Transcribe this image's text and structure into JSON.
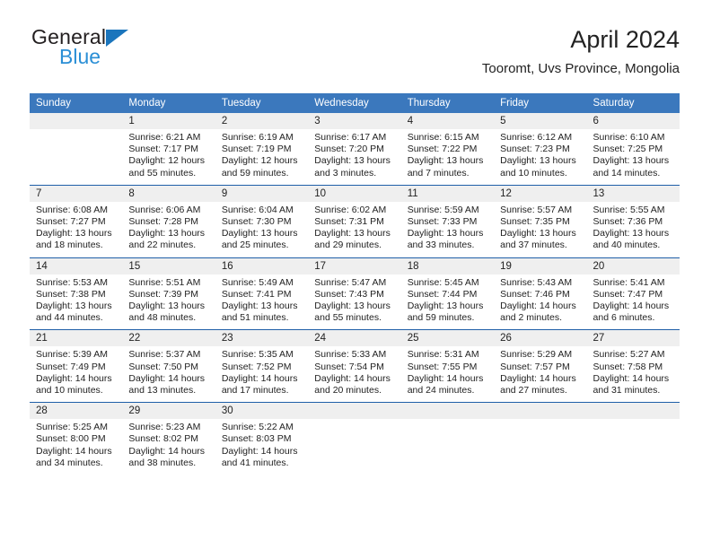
{
  "brand": {
    "word1": "General",
    "word2": "Blue",
    "triangle_color": "#1b75bc",
    "word2_color": "#2b8fd6"
  },
  "header": {
    "title": "April 2024",
    "subtitle": "Tooromt, Uvs Province, Mongolia"
  },
  "theme": {
    "header_bg": "#3b78bd",
    "daynum_bg": "#efefef",
    "separator": "#1f5fa8",
    "text": "#222222"
  },
  "calendar": {
    "weekday_headers": [
      "Sunday",
      "Monday",
      "Tuesday",
      "Wednesday",
      "Thursday",
      "Friday",
      "Saturday"
    ],
    "weeks": [
      {
        "days": [
          {
            "num": "",
            "lines": []
          },
          {
            "num": "1",
            "lines": [
              "Sunrise: 6:21 AM",
              "Sunset: 7:17 PM",
              "Daylight: 12 hours",
              "and 55 minutes."
            ]
          },
          {
            "num": "2",
            "lines": [
              "Sunrise: 6:19 AM",
              "Sunset: 7:19 PM",
              "Daylight: 12 hours",
              "and 59 minutes."
            ]
          },
          {
            "num": "3",
            "lines": [
              "Sunrise: 6:17 AM",
              "Sunset: 7:20 PM",
              "Daylight: 13 hours",
              "and 3 minutes."
            ]
          },
          {
            "num": "4",
            "lines": [
              "Sunrise: 6:15 AM",
              "Sunset: 7:22 PM",
              "Daylight: 13 hours",
              "and 7 minutes."
            ]
          },
          {
            "num": "5",
            "lines": [
              "Sunrise: 6:12 AM",
              "Sunset: 7:23 PM",
              "Daylight: 13 hours",
              "and 10 minutes."
            ]
          },
          {
            "num": "6",
            "lines": [
              "Sunrise: 6:10 AM",
              "Sunset: 7:25 PM",
              "Daylight: 13 hours",
              "and 14 minutes."
            ]
          }
        ]
      },
      {
        "days": [
          {
            "num": "7",
            "lines": [
              "Sunrise: 6:08 AM",
              "Sunset: 7:27 PM",
              "Daylight: 13 hours",
              "and 18 minutes."
            ]
          },
          {
            "num": "8",
            "lines": [
              "Sunrise: 6:06 AM",
              "Sunset: 7:28 PM",
              "Daylight: 13 hours",
              "and 22 minutes."
            ]
          },
          {
            "num": "9",
            "lines": [
              "Sunrise: 6:04 AM",
              "Sunset: 7:30 PM",
              "Daylight: 13 hours",
              "and 25 minutes."
            ]
          },
          {
            "num": "10",
            "lines": [
              "Sunrise: 6:02 AM",
              "Sunset: 7:31 PM",
              "Daylight: 13 hours",
              "and 29 minutes."
            ]
          },
          {
            "num": "11",
            "lines": [
              "Sunrise: 5:59 AM",
              "Sunset: 7:33 PM",
              "Daylight: 13 hours",
              "and 33 minutes."
            ]
          },
          {
            "num": "12",
            "lines": [
              "Sunrise: 5:57 AM",
              "Sunset: 7:35 PM",
              "Daylight: 13 hours",
              "and 37 minutes."
            ]
          },
          {
            "num": "13",
            "lines": [
              "Sunrise: 5:55 AM",
              "Sunset: 7:36 PM",
              "Daylight: 13 hours",
              "and 40 minutes."
            ]
          }
        ]
      },
      {
        "days": [
          {
            "num": "14",
            "lines": [
              "Sunrise: 5:53 AM",
              "Sunset: 7:38 PM",
              "Daylight: 13 hours",
              "and 44 minutes."
            ]
          },
          {
            "num": "15",
            "lines": [
              "Sunrise: 5:51 AM",
              "Sunset: 7:39 PM",
              "Daylight: 13 hours",
              "and 48 minutes."
            ]
          },
          {
            "num": "16",
            "lines": [
              "Sunrise: 5:49 AM",
              "Sunset: 7:41 PM",
              "Daylight: 13 hours",
              "and 51 minutes."
            ]
          },
          {
            "num": "17",
            "lines": [
              "Sunrise: 5:47 AM",
              "Sunset: 7:43 PM",
              "Daylight: 13 hours",
              "and 55 minutes."
            ]
          },
          {
            "num": "18",
            "lines": [
              "Sunrise: 5:45 AM",
              "Sunset: 7:44 PM",
              "Daylight: 13 hours",
              "and 59 minutes."
            ]
          },
          {
            "num": "19",
            "lines": [
              "Sunrise: 5:43 AM",
              "Sunset: 7:46 PM",
              "Daylight: 14 hours",
              "and 2 minutes."
            ]
          },
          {
            "num": "20",
            "lines": [
              "Sunrise: 5:41 AM",
              "Sunset: 7:47 PM",
              "Daylight: 14 hours",
              "and 6 minutes."
            ]
          }
        ]
      },
      {
        "days": [
          {
            "num": "21",
            "lines": [
              "Sunrise: 5:39 AM",
              "Sunset: 7:49 PM",
              "Daylight: 14 hours",
              "and 10 minutes."
            ]
          },
          {
            "num": "22",
            "lines": [
              "Sunrise: 5:37 AM",
              "Sunset: 7:50 PM",
              "Daylight: 14 hours",
              "and 13 minutes."
            ]
          },
          {
            "num": "23",
            "lines": [
              "Sunrise: 5:35 AM",
              "Sunset: 7:52 PM",
              "Daylight: 14 hours",
              "and 17 minutes."
            ]
          },
          {
            "num": "24",
            "lines": [
              "Sunrise: 5:33 AM",
              "Sunset: 7:54 PM",
              "Daylight: 14 hours",
              "and 20 minutes."
            ]
          },
          {
            "num": "25",
            "lines": [
              "Sunrise: 5:31 AM",
              "Sunset: 7:55 PM",
              "Daylight: 14 hours",
              "and 24 minutes."
            ]
          },
          {
            "num": "26",
            "lines": [
              "Sunrise: 5:29 AM",
              "Sunset: 7:57 PM",
              "Daylight: 14 hours",
              "and 27 minutes."
            ]
          },
          {
            "num": "27",
            "lines": [
              "Sunrise: 5:27 AM",
              "Sunset: 7:58 PM",
              "Daylight: 14 hours",
              "and 31 minutes."
            ]
          }
        ]
      },
      {
        "days": [
          {
            "num": "28",
            "lines": [
              "Sunrise: 5:25 AM",
              "Sunset: 8:00 PM",
              "Daylight: 14 hours",
              "and 34 minutes."
            ]
          },
          {
            "num": "29",
            "lines": [
              "Sunrise: 5:23 AM",
              "Sunset: 8:02 PM",
              "Daylight: 14 hours",
              "and 38 minutes."
            ]
          },
          {
            "num": "30",
            "lines": [
              "Sunrise: 5:22 AM",
              "Sunset: 8:03 PM",
              "Daylight: 14 hours",
              "and 41 minutes."
            ]
          },
          {
            "num": "",
            "lines": []
          },
          {
            "num": "",
            "lines": []
          },
          {
            "num": "",
            "lines": []
          },
          {
            "num": "",
            "lines": []
          }
        ]
      }
    ]
  }
}
